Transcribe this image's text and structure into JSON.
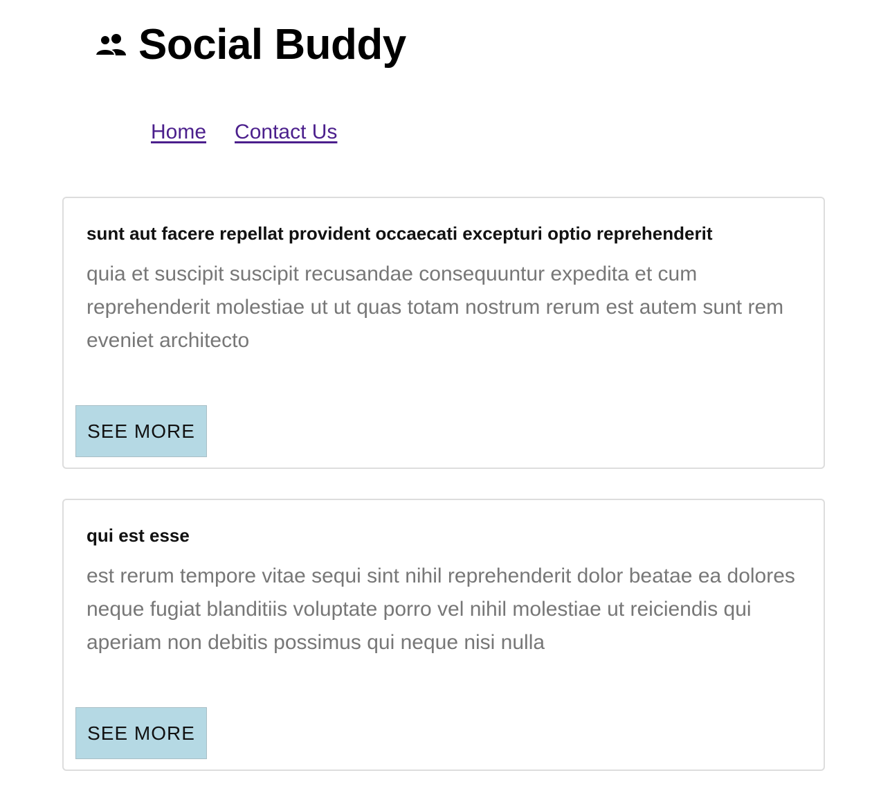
{
  "header": {
    "title": "Social Buddy",
    "icon": "people-icon"
  },
  "nav": {
    "home": "Home",
    "contact": "Contact Us"
  },
  "posts": [
    {
      "title": "sunt aut facere repellat provident occaecati excepturi optio reprehenderit",
      "body": "quia et suscipit suscipit recusandae consequuntur expedita et cum reprehenderit molestiae ut ut quas totam nostrum rerum est autem sunt rem eveniet architecto",
      "button": "SEE MORE"
    },
    {
      "title": "qui est esse",
      "body": "est rerum tempore vitae sequi sint nihil reprehenderit dolor beatae ea dolores neque fugiat blanditiis voluptate porro vel nihil molestiae ut reiciendis qui aperiam non debitis possimus qui neque nisi nulla",
      "button": "SEE MORE"
    }
  ],
  "colors": {
    "link": "#4b1f8c",
    "button_bg": "#b5d9e4",
    "body_text": "#777777",
    "card_border": "#dddddd"
  }
}
